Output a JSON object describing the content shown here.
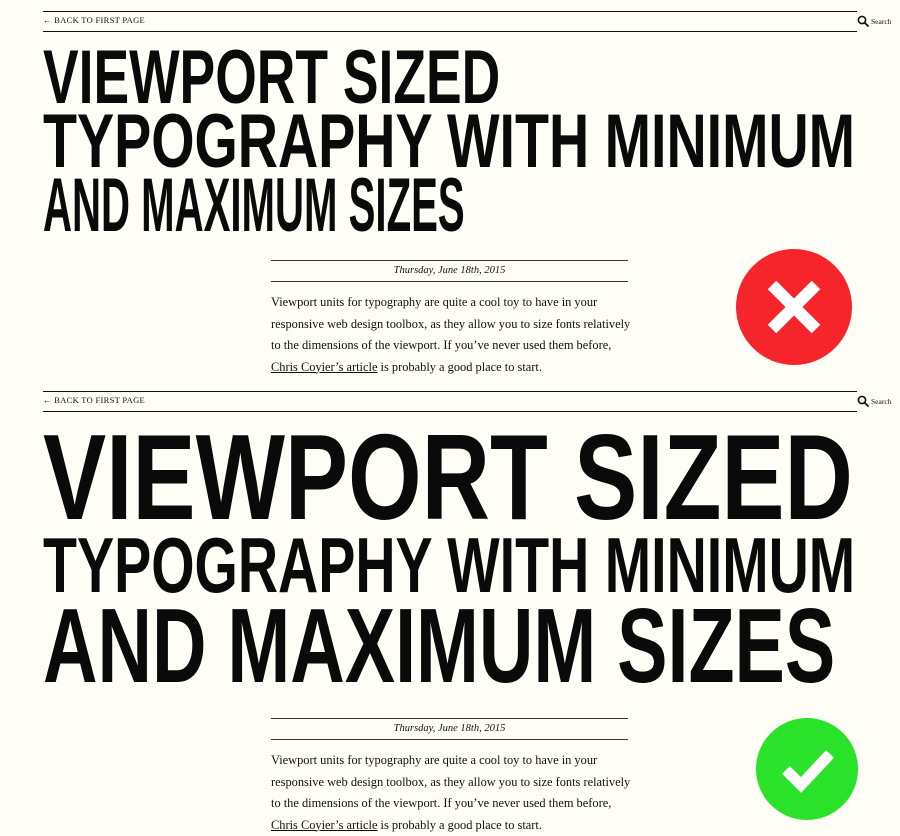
{
  "colors": {
    "background": "#fefdf6",
    "text": "#111111",
    "wrong_badge": "#f5252b",
    "right_badge": "#2ae22a"
  },
  "example_bad": {
    "nav": {
      "back_label": "← BACK TO FIRST PAGE",
      "search_label": "Search",
      "search_icon": "search-icon"
    },
    "headline": {
      "line1": "VIEWPORT SIZED",
      "line2": "TYPOGRAPHY WITH MINIMUM",
      "line3": "AND MAXIMUM SIZES"
    },
    "date": "Thursday, June 18th, 2015",
    "body": {
      "text_before_link": "Viewport units for typography are quite a cool toy to have in your responsive web design toolbox, as they allow you to size fonts relatively to the dimensions of the viewport. If you’ve never used them before, ",
      "link_text": "Chris Coyier’s article",
      "text_after_link": " is probably a good place to start."
    },
    "badge_icon": "cross-icon"
  },
  "example_good": {
    "nav": {
      "back_label": "← BACK TO FIRST PAGE",
      "search_label": "Search",
      "search_icon": "search-icon"
    },
    "headline": {
      "line1": "VIEWPORT SIZED",
      "line2": "TYPOGRAPHY WITH MINIMUM",
      "line3": "AND MAXIMUM SIZES"
    },
    "date": "Thursday, June 18th, 2015",
    "body": {
      "text_before_link": "Viewport units for typography are quite a cool toy to have in your responsive web design toolbox, as they allow you to size fonts relatively to the dimensions of the viewport. If you’ve never used them before, ",
      "link_text": "Chris Coyier’s article",
      "text_after_link": " is probably a good place to start."
    },
    "badge_icon": "checkmark-icon"
  }
}
